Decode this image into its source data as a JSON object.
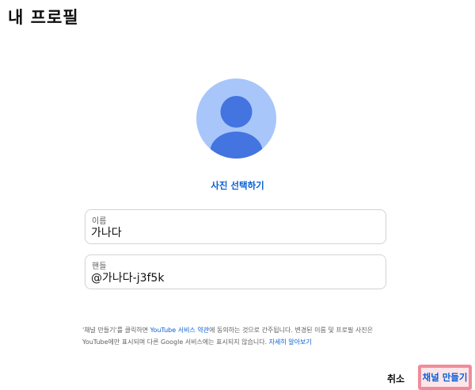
{
  "header": {
    "title": "내 프로필"
  },
  "avatar": {
    "icon": "person-silhouette-icon",
    "background": "#a8c6fa",
    "figure_color": "#4374e0"
  },
  "photo": {
    "select_label": "사진 선택하기"
  },
  "fields": {
    "name": {
      "label": "이름",
      "value": "가나다"
    },
    "handle": {
      "label": "핸들",
      "value": "@가나다-j3f5k"
    }
  },
  "terms": {
    "part1": "'채널 만들기'를 클릭하면 ",
    "terms_link": "YouTube 서비스 약관",
    "part2": "에 동의하는 것으로 간주됩니다. 변경된 이름 및 프로필 사진은 YouTube에만 표시되며 다른 Google 서비스에는 표시되지 않습니다. ",
    "learn_more_link": "자세히 알아보기"
  },
  "actions": {
    "cancel_label": "취소",
    "create_label": "채널 만들기"
  },
  "colors": {
    "link": "#065fd4",
    "highlight_border": "#ef8c9b",
    "highlight_fill": "#fde6ea"
  }
}
